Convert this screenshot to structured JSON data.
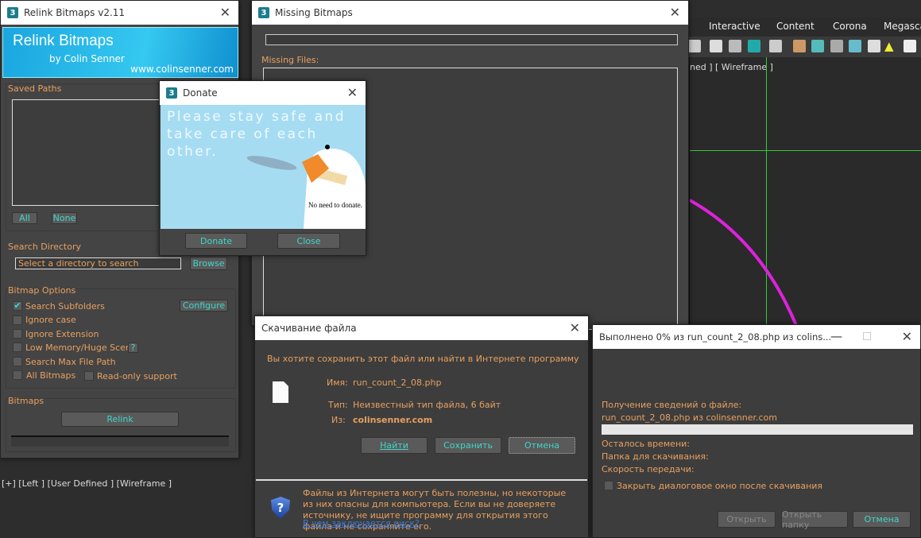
{
  "max": {
    "menu": [
      "Interactive",
      "Content",
      "Corona",
      "Megascan"
    ],
    "viewport_right_label": "ned ] [ Wireframe ]",
    "viewport_left_label": "[+] [Left ] [User Defined ] [Wireframe ]"
  },
  "relink": {
    "title": "Relink Bitmaps v2.11",
    "banner_title": "Relink Bitmaps",
    "banner_by": "by Colin Senner",
    "banner_url": "www.colinsenner.com",
    "saved_paths": "Saved Paths",
    "all": "All",
    "none": "None",
    "search_dir": "Search Directory",
    "dir_placeholder": "Select a directory to search",
    "browse": "Browse",
    "bitmap_options": "Bitmap Options",
    "configure": "Configure",
    "options": [
      {
        "label": "Search Subfolders",
        "checked": true
      },
      {
        "label": "Ignore case",
        "checked": false
      },
      {
        "label": "Ignore Extension",
        "checked": false
      },
      {
        "label": "Low Memory/Huge Scene",
        "checked": false
      },
      {
        "label": "Search Max File Path",
        "checked": false
      },
      {
        "label": "All Bitmaps",
        "checked": false
      }
    ],
    "readonly": "Read-only support",
    "help": "?",
    "bitmaps": "Bitmaps",
    "relink": "Relink"
  },
  "missing": {
    "title": "Missing Bitmaps",
    "missing_files": "Missing Files:"
  },
  "donate": {
    "title": "Donate",
    "message": "Please stay safe and take care of each other.",
    "no_need": "No need to donate.",
    "donate": "Donate",
    "close": "Close"
  },
  "download": {
    "title": "Скачивание файла",
    "question": "Вы хотите сохранить этот файл или найти в Интернете программу для его о",
    "name_label": "Имя:",
    "name": "run_count_2_08.php",
    "type_label": "Тип:",
    "type": "Неизвестный тип файла, 6 байт",
    "from_label": "Из:",
    "from": "colinsenner.com",
    "find": "Найти",
    "save": "Сохранить",
    "cancel": "Отмена",
    "warning": "Файлы из Интернета могут быть полезны, но некоторые из них опасны для компьютера. Если вы не доверяете источнику, не ищите программу для открытия этого файла и не сохраняйте его.",
    "risk_link": "В чем заключается риск?"
  },
  "progress": {
    "title": "Выполнено 0% из run_count_2_08.php из colins...",
    "getting": "Получение сведений о файле:",
    "file": "run_count_2_08.php из colinsenner.com",
    "percent": 0,
    "time_left": "Осталось времени:",
    "folder": "Папка для скачивания:",
    "speed": "Скорость передачи:",
    "close_after": "Закрыть диалоговое окно после скачивания",
    "open": "Открыть",
    "open_folder": "Открыть папку",
    "cancel": "Отмена"
  }
}
